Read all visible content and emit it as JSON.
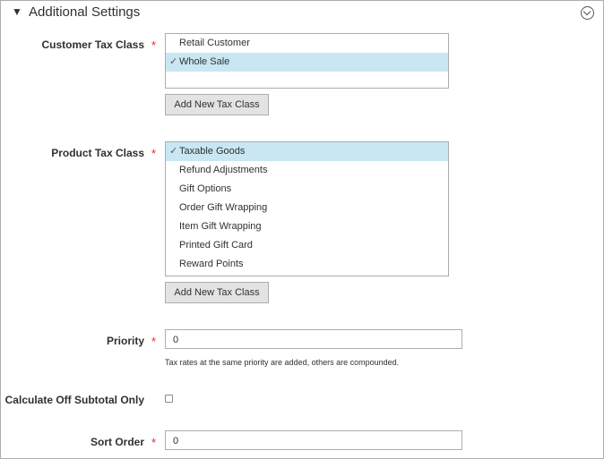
{
  "section": {
    "title": "Additional Settings"
  },
  "customer_tax_class": {
    "label": "Customer Tax Class",
    "required_mark": "*",
    "options": [
      {
        "label": "Retail Customer",
        "selected": false
      },
      {
        "label": "Whole Sale",
        "selected": true
      },
      {
        "label": "",
        "selected": false
      }
    ],
    "add_button": "Add New Tax Class"
  },
  "product_tax_class": {
    "label": "Product Tax Class",
    "required_mark": "*",
    "options": [
      {
        "label": "Taxable Goods",
        "selected": true
      },
      {
        "label": "Refund Adjustments",
        "selected": false
      },
      {
        "label": "Gift Options",
        "selected": false
      },
      {
        "label": "Order Gift Wrapping",
        "selected": false
      },
      {
        "label": "Item Gift Wrapping",
        "selected": false
      },
      {
        "label": "Printed Gift Card",
        "selected": false
      },
      {
        "label": "Reward Points",
        "selected": false
      }
    ],
    "add_button": "Add New Tax Class"
  },
  "priority": {
    "label": "Priority",
    "required_mark": "*",
    "value": "0",
    "note": "Tax rates at the same priority are added, others are compounded."
  },
  "calculate_off_subtotal": {
    "label": "Calculate Off Subtotal Only",
    "checked": false
  },
  "sort_order": {
    "label": "Sort Order",
    "required_mark": "*",
    "value": "0"
  },
  "glyphs": {
    "collapse_arrow": "▼",
    "check": "✓"
  }
}
